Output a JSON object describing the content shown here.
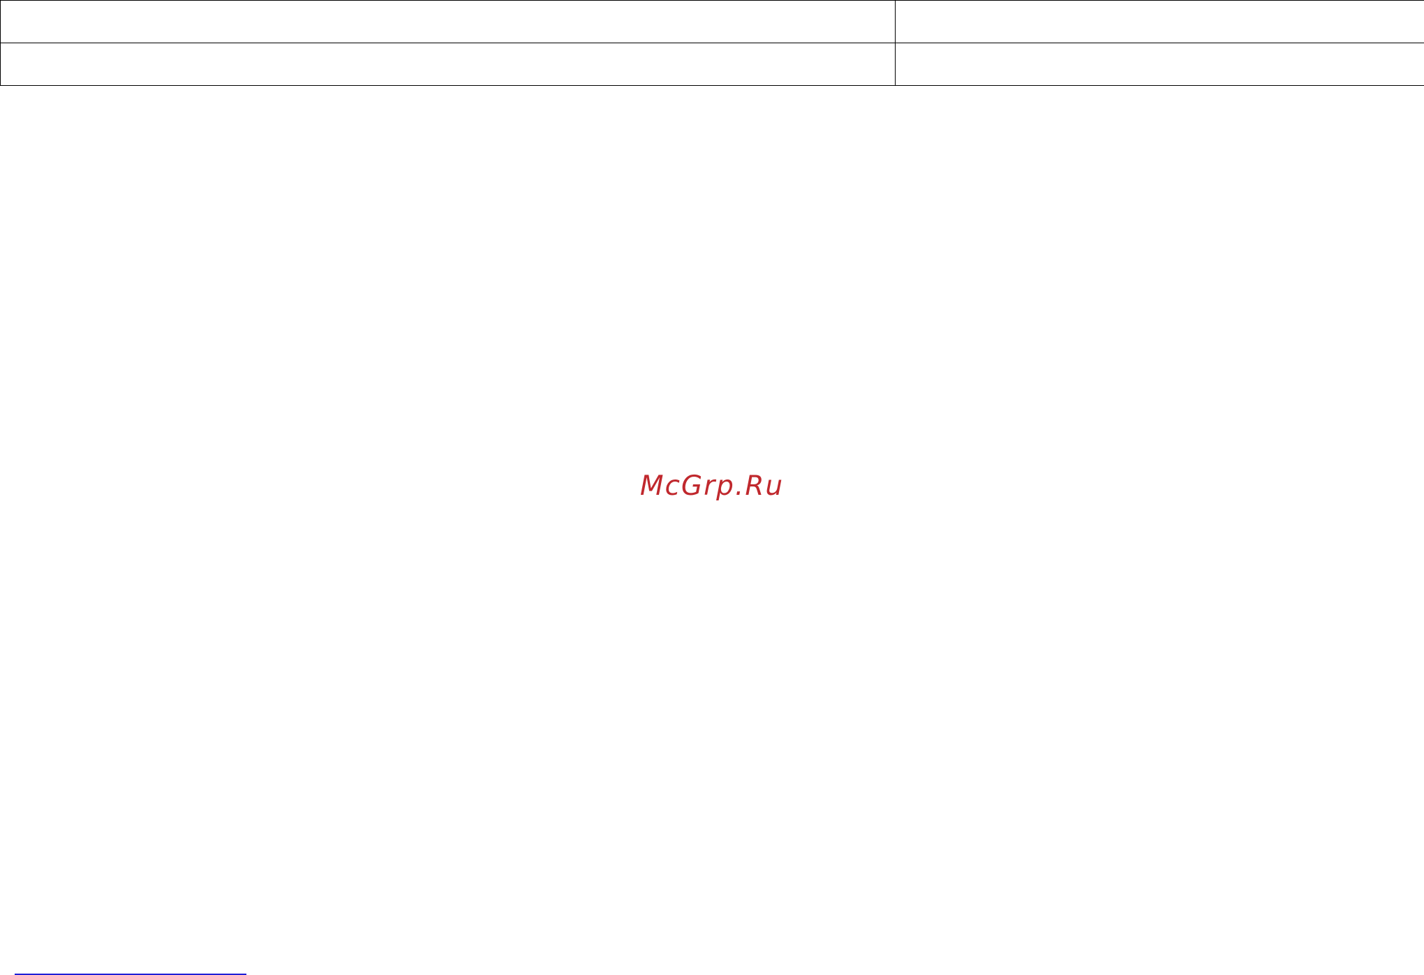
{
  "watermark": {
    "text": "McGrp.Ru",
    "color": "#c0282d"
  },
  "table": {
    "rows": [
      [
        "",
        ""
      ],
      [
        "",
        ""
      ]
    ]
  },
  "footnote_rule_color": "#1f1fd6"
}
